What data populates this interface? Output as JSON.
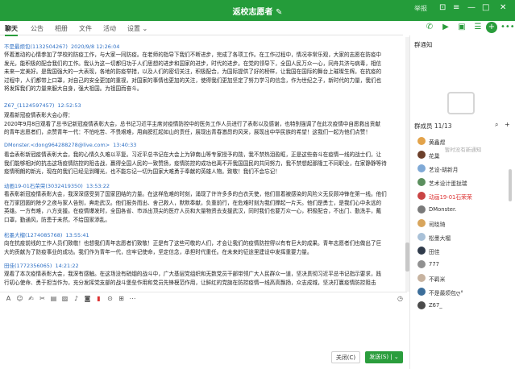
{
  "window": {
    "title": "返校志愿者",
    "edit_icon": "pencil-icon",
    "top_right_text": "举报",
    "controls": [
      "minimize",
      "maximize",
      "close"
    ]
  },
  "tabs": [
    "聊天",
    "公告",
    "相册",
    "文件",
    "活动",
    "设置"
  ],
  "toolbar": {
    "icons": [
      "phone-icon",
      "video-icon",
      "screen-share-icon",
      "homework-icon",
      "add-icon",
      "more-icon"
    ]
  },
  "messages": [
    {
      "sender": "不是最烦包",
      "id": "(1132504267)",
      "time": "2020/9/8 12:26:04",
      "lines": [
        "怀着激动的心情参加了学校的防疫工作，与大家一同防疫。在老师的指导下我们不断进步，完成了各项工作。在工作过程中，情况非常乐观，大家的志愿在防疫中",
        "发光，能积极的配合我们的工作。我认为这一切都归功于人们思想的进步和国家的进步，时代的进步。在党的领导下，全国人民万众一心，同舟共济与病毒，相信",
        "未来一定美好。是我国强大的一大表现，各地的防疫举措，以及人们的密切关注，积极配合，为国际提供了好的榜样，让我国在国际的舞台上璀璨生辉。在抗疫的",
        "过程中，人们都带上口罩，对自己的安全更加的重视，对国家的事情也更加的关注，使得我们更加坚定了努力学习的信念，作为世纪之子，新时代的力量，我们也",
        "将发挥我们的力量来服大自身，强大祖国。为祖国而奋斗。"
      ]
    },
    {
      "sender": "Z67_",
      "id": "(1124597457)",
      "time": "12:52:53",
      "lines": [
        "观看新冠疫情表彰大会心得：",
        "2020年9月8日观看了总书记新冠疫情表彰大会，总书记习近平主席对疫情防控中的医务工作人员进行了表彰以及感谢，也特别强调了在此次疫情中自愿救出贡献",
        "的青年志愿者们，点赞青年一代：不怕吃苦、不畏艰难，用肩膀扛起如山的责任，展现出青春激昂的风采，展现出中华民族的希望！这我们一起为他们点赞！"
      ]
    },
    {
      "sender": "DMonster.",
      "id": "<dong964288278@live.com>",
      "time": "13:40:33",
      "lines": [
        "看会表彰新冠疫情表彰大会，我的心情久久难以平复。习近平总书记在大会上为钟南山等专家授予的勋，我不禁热泪盈眶，正是这些奋斗在疫情一线的战士们，让",
        "我们能够相对的抗击这场疫情防控的阻击战，赢得全国人民的一致赞扬，疫情防控的成功也离不开我国国民的共同努力，我不禁想起那隆工不同职业，在家静静等待",
        "疫情明朗的新光，现在的我们已经见到曙光，也不能忘记一切为国家大难勇于奉献的英雄人物。致敬！我们不会忘记！"
      ]
    },
    {
      "sender": "动画19-01石荣荣",
      "id": "(3032419350)",
      "time": "13:53:22",
      "lines": [
        "看表彰新冠疫情表彰大会，我深深感受到了国家团结的力量。在这样危难的时刻，涌现了许许多多的白衣天使，他们冒着被感染的风险义无反顾冲锋在第一线。他们",
        "在万家团圆的除夕之夜与家人告别，奔赴武汉。他们报务而出、舍己救人，默默奉献，负重前行，在危难时刻为我们撑起一片天。他们是勇士，是我们心中永远的",
        "英雄。一方有难，八方支援。在疫情爆发时，全国各省、市派出顶尖的医疗人员和大量物资去支援武汉，同时我们也要万众一心，积极配合，不出门、勤洗手，戴",
        "口罩，勤通风，防患于未然，不给国家添乱。"
      ]
    },
    {
      "sender": "松墨大榴",
      "id": "(1274085768)",
      "time": "13:55:41",
      "lines": [
        "向在抗疫前线的工作人员们致敬！也想我们青年志愿者们致敬！正是有了这些可敬的人们，才会让我们的疫情防控得以有有巨大的成果。青年志愿者们也做出了巨",
        "大的贡献为了防疫事业的成功。我们作为青年一代，应牢记使命，坚定信念，承担时代重任。在未来的征途里建设中发挥重要力量。"
      ]
    },
    {
      "sender": "田佳",
      "id": "(1772356065)",
      "time": "14:21:22",
      "lines": [
        "观看了本次疫情表彰大会，我深有感触。在这场没有硝烟的战斗中，广大基层党组织和无数党员干部带领广大人民群众一道，坚决贯彻习近平总书记指示要求，践",
        "行初心使命、勇于担当作为，充分发挥党支部的战斗堡垒作用和党员先锋模范作用，让鲜红的党旗在防控疫情一线高高飘扬，众志成城，坚决打赢疫情防控阻击"
      ]
    }
  ],
  "input_toolbar": {
    "icons": [
      "font-icon",
      "emoji-icon",
      "gesture-icon",
      "scissors-icon",
      "file-icon",
      "image-icon",
      "music-icon",
      "camera-icon",
      "red-packet-icon",
      "mic-icon",
      "grid-icon",
      "more-icon"
    ]
  },
  "buttons": {
    "close": "关闭(C)",
    "send": "发送(S)"
  },
  "right": {
    "notice_title": "群通知",
    "notice_empty": "暂时没有新通知",
    "members_title": "群成员 11/13",
    "members": [
      {
        "name": "黄鑫煜",
        "color": "#e3a34a",
        "red": false
      },
      {
        "name": "花巢",
        "color": "#6c3f2a",
        "red": false
      },
      {
        "name": "艺设-胡新月",
        "color": "#7fa9d6",
        "red": false
      },
      {
        "name": "艺术设计蛋挞瑞",
        "color": "#5b8f5e",
        "red": false
      },
      {
        "name": "动画19-01石荣荣",
        "color": "#c94444",
        "red": true
      },
      {
        "name": "DMonster.",
        "color": "#7a7a7a",
        "red": false
      },
      {
        "name": "司晓琦",
        "color": "#d8a55c",
        "red": false
      },
      {
        "name": "松墨大榴",
        "color": "#a9c1d8",
        "red": false
      },
      {
        "name": "田佳",
        "color": "#2f3a4a",
        "red": false
      },
      {
        "name": "777",
        "color": "#909090",
        "red": false
      },
      {
        "name": "不羁米",
        "color": "#c7b3a0",
        "red": false
      },
      {
        "name": "不是最烦包ღ°",
        "color": "#3c6e9a",
        "red": false
      },
      {
        "name": "Z67_",
        "color": "#4a4a4a",
        "red": false
      }
    ]
  },
  "colors": {
    "brand": "#249c3a",
    "link": "#2d6fc4",
    "highlight": "#d33"
  }
}
